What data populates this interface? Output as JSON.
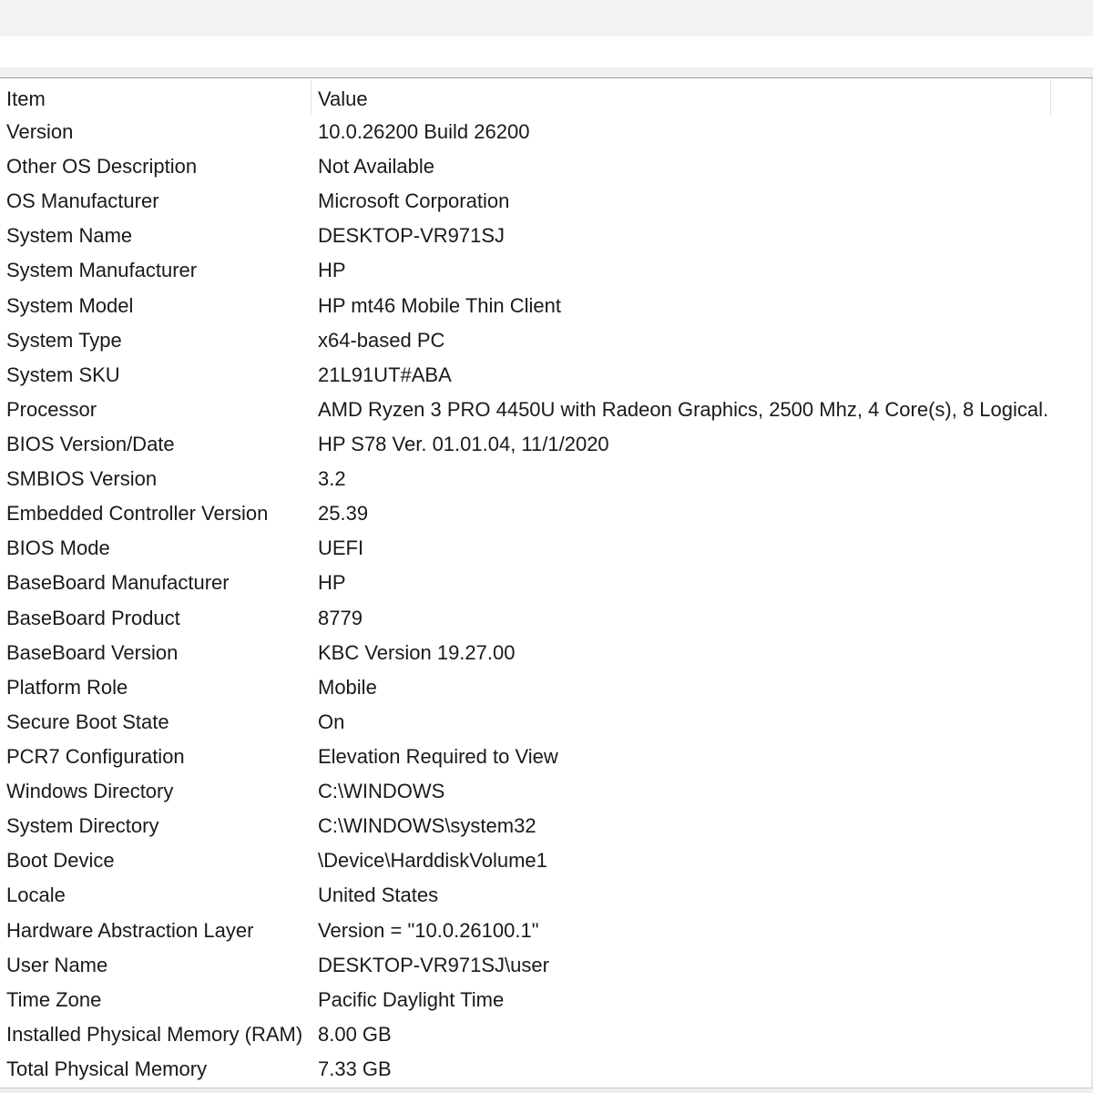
{
  "table": {
    "columns": [
      "Item",
      "Value"
    ],
    "rows": [
      {
        "item": "Version",
        "value": "10.0.26200 Build 26200"
      },
      {
        "item": "Other OS Description",
        "value": "Not Available"
      },
      {
        "item": "OS Manufacturer",
        "value": "Microsoft Corporation"
      },
      {
        "item": "System Name",
        "value": "DESKTOP-VR971SJ"
      },
      {
        "item": "System Manufacturer",
        "value": "HP"
      },
      {
        "item": "System Model",
        "value": "HP mt46 Mobile Thin Client"
      },
      {
        "item": "System Type",
        "value": "x64-based PC"
      },
      {
        "item": "System SKU",
        "value": "21L91UT#ABA"
      },
      {
        "item": "Processor",
        "value": "AMD Ryzen 3 PRO 4450U with Radeon Graphics, 2500 Mhz, 4 Core(s), 8 Logical..."
      },
      {
        "item": "BIOS Version/Date",
        "value": "HP S78 Ver. 01.01.04, 11/1/2020"
      },
      {
        "item": "SMBIOS Version",
        "value": "3.2"
      },
      {
        "item": "Embedded Controller Version",
        "value": "25.39"
      },
      {
        "item": "BIOS Mode",
        "value": "UEFI"
      },
      {
        "item": "BaseBoard Manufacturer",
        "value": "HP"
      },
      {
        "item": "BaseBoard Product",
        "value": "8779"
      },
      {
        "item": "BaseBoard Version",
        "value": "KBC Version 19.27.00"
      },
      {
        "item": "Platform Role",
        "value": "Mobile"
      },
      {
        "item": "Secure Boot State",
        "value": "On"
      },
      {
        "item": "PCR7 Configuration",
        "value": "Elevation Required to View"
      },
      {
        "item": "Windows Directory",
        "value": "C:\\WINDOWS"
      },
      {
        "item": "System Directory",
        "value": "C:\\WINDOWS\\system32"
      },
      {
        "item": "Boot Device",
        "value": "\\Device\\HarddiskVolume1"
      },
      {
        "item": "Locale",
        "value": "United States"
      },
      {
        "item": "Hardware Abstraction Layer",
        "value": "Version = \"10.0.26100.1\""
      },
      {
        "item": "User Name",
        "value": "DESKTOP-VR971SJ\\user"
      },
      {
        "item": "Time Zone",
        "value": "Pacific Daylight Time"
      },
      {
        "item": "Installed Physical Memory (RAM)",
        "value": "8.00 GB"
      },
      {
        "item": "Total Physical Memory",
        "value": "7.33 GB"
      }
    ]
  }
}
